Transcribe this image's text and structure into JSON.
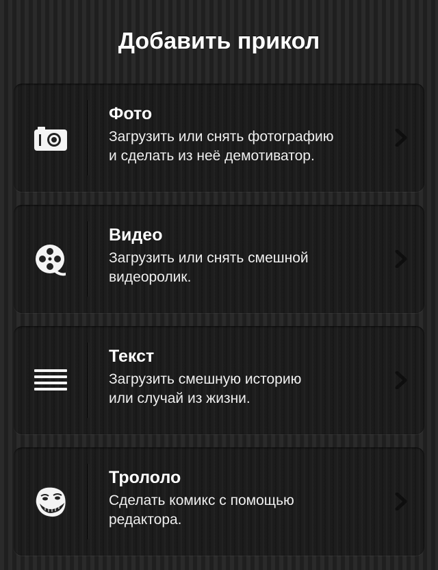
{
  "header": {
    "title": "Добавить прикол"
  },
  "menu": {
    "items": [
      {
        "title": "Фото",
        "description": "Загрузить или снять фотографию\nи сделать из неё демотиватор.",
        "icon": "camera-icon"
      },
      {
        "title": "Видео",
        "description": "Загрузить или снять смешной\nвидеоролик.",
        "icon": "film-reel-icon"
      },
      {
        "title": "Текст",
        "description": "Загрузить смешную историю\nили случай из жизни.",
        "icon": "text-lines-icon"
      },
      {
        "title": "Трололо",
        "description": "Сделать комикс с помощью\nредактора.",
        "icon": "troll-face-icon"
      }
    ]
  },
  "colors": {
    "background": "#222222",
    "text": "#ffffff",
    "chevron": "#0e0e0e"
  }
}
